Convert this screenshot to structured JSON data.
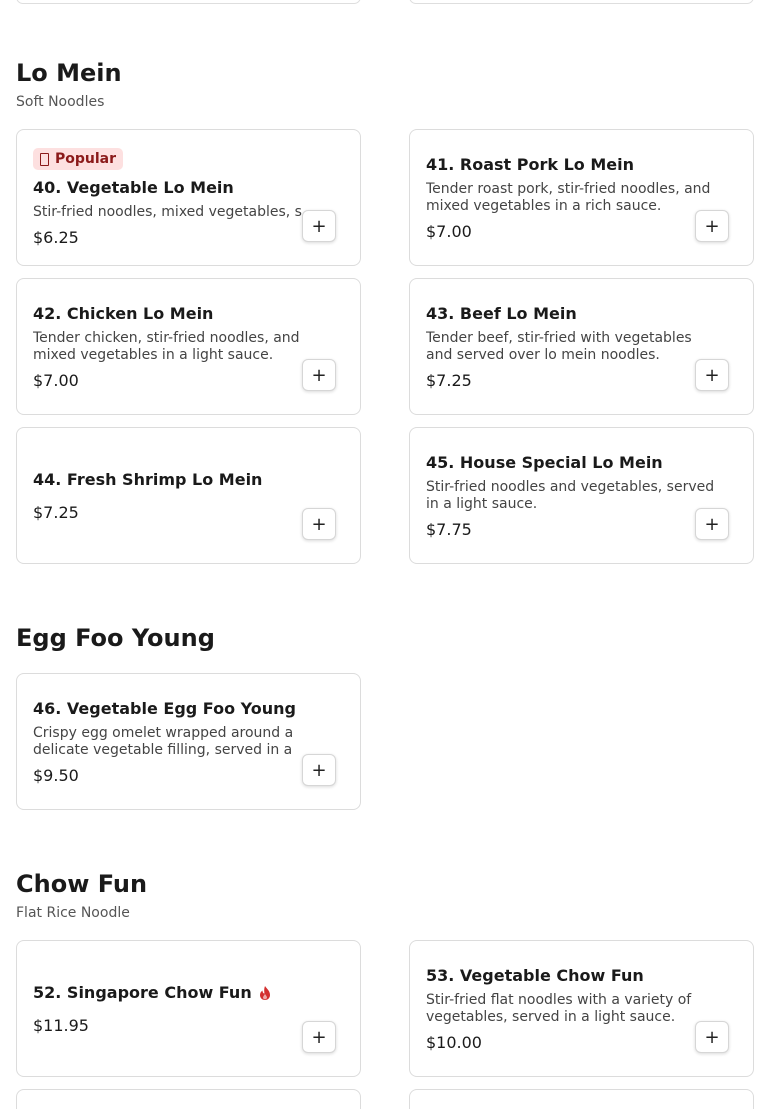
{
  "sections": [
    {
      "title": "Lo Mein",
      "subtitle": "Soft Noodles",
      "items": [
        {
          "name": "40. Vegetable Lo Mein",
          "badge": "Popular",
          "description": "Stir-fried noodles, mixed vegetables, s...",
          "price": "$6.25",
          "add": "+"
        },
        {
          "name": "41. Roast Pork Lo Mein",
          "description": "Tender roast pork, stir-fried noodles, and mixed vegetables in a rich sauce.",
          "price": "$7.00",
          "add": "+"
        },
        {
          "name": "42. Chicken Lo Mein",
          "description": "Tender chicken, stir-fried noodles, and mixed vegetables in a light sauce.",
          "price": "$7.00",
          "add": "+"
        },
        {
          "name": "43. Beef Lo Mein",
          "description": "Tender beef, stir-fried with vegetables and served over lo mein noodles.",
          "price": "$7.25",
          "add": "+"
        },
        {
          "name": "44. Fresh Shrimp Lo Mein",
          "price": "$7.25",
          "add": "+"
        },
        {
          "name": "45. House Special Lo Mein",
          "description": "Stir-fried noodles and vegetables, served in a light sauce.",
          "price": "$7.75",
          "add": "+"
        }
      ]
    },
    {
      "title": "Egg Foo Young",
      "items": [
        {
          "name": "46. Vegetable Egg Foo Young",
          "description": "Crispy egg omelet wrapped around a delicate vegetable filling, served in a light ...",
          "price": "$9.50",
          "add": "+"
        }
      ]
    },
    {
      "title": "Chow Fun",
      "subtitle": "Flat Rice Noodle",
      "items": [
        {
          "name": "52. Singapore Chow Fun",
          "spicy_icon": "flame-icon",
          "price": "$11.95",
          "add": "+"
        },
        {
          "name": "53. Vegetable Chow Fun",
          "description": "Stir-fried flat noodles with a variety of vegetables, served in a light sauce.",
          "price": "$10.00",
          "add": "+"
        }
      ]
    }
  ],
  "colors": {
    "badge_bg": "#fde0e0",
    "badge_text": "#8b1a1a",
    "spicy": "#d32f2f"
  }
}
